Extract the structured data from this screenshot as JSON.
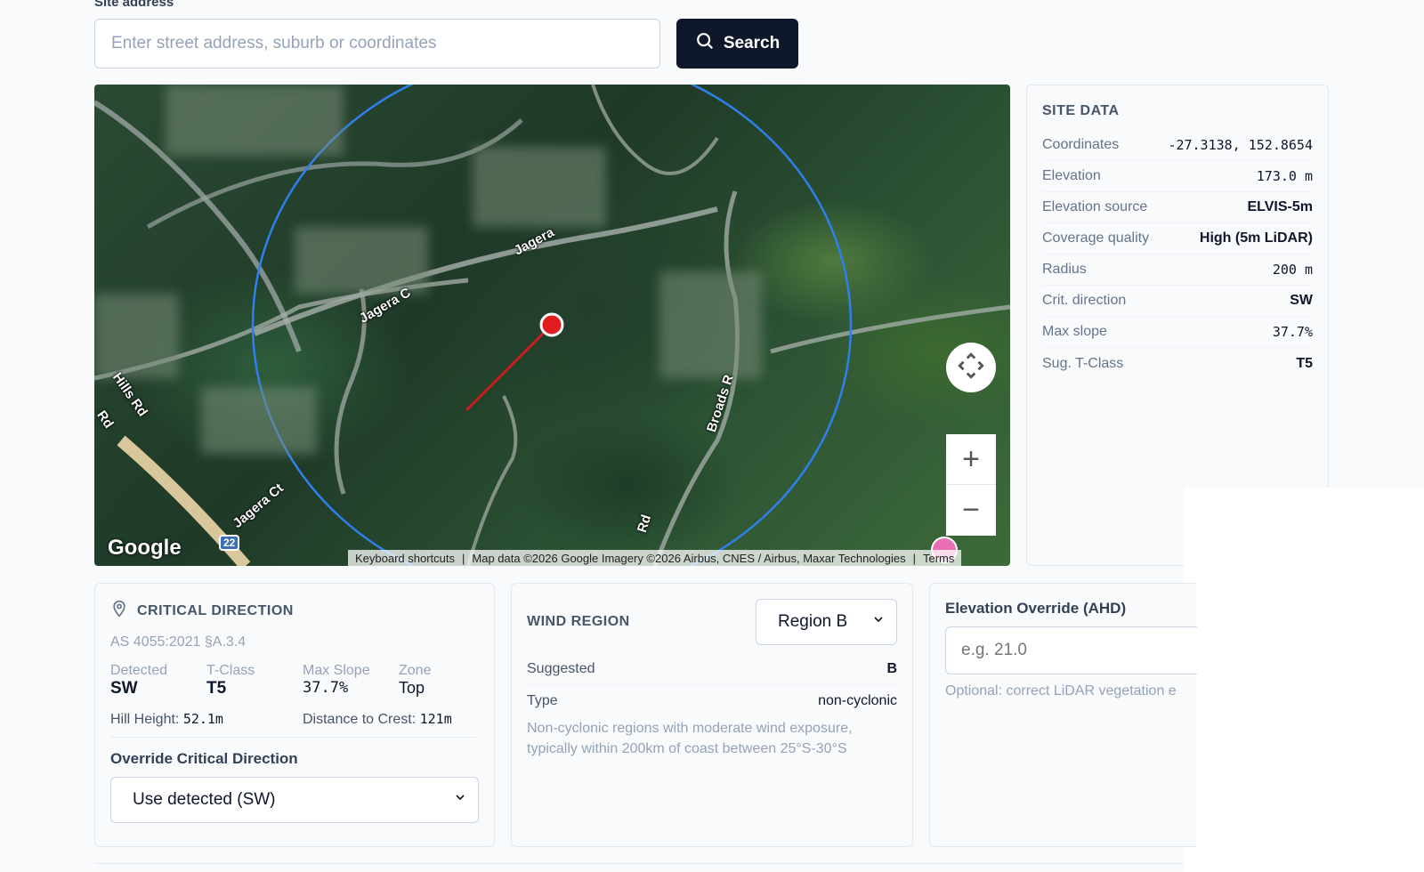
{
  "search": {
    "label": "Site address",
    "placeholder": "Enter street address, suburb or coordinates",
    "button_label": "Search"
  },
  "map": {
    "labels": [
      "Jagera",
      "Jagera C",
      "Hills Rd",
      "Rd",
      "Jagera Ct",
      "Broads R",
      "Rd",
      "22"
    ],
    "attribution": {
      "shortcuts": "Keyboard shortcuts",
      "data": "Map data ©2026 Google Imagery ©2026 Airbus, CNES / Airbus, Maxar Technologies",
      "terms": "Terms"
    },
    "logo": "Google",
    "zoom_in": "+",
    "zoom_out": "−"
  },
  "site_data": {
    "title": "SITE DATA",
    "rows": [
      {
        "k": "Coordinates",
        "v": "-27.3138, 152.8654"
      },
      {
        "k": "Elevation",
        "v": "173.0 m"
      },
      {
        "k": "Elevation source",
        "v": "ELVIS-5m"
      },
      {
        "k": "Coverage quality",
        "v": "High (5m LiDAR)"
      },
      {
        "k": "Radius",
        "v": "200 m"
      },
      {
        "k": "Crit. direction",
        "v": "SW"
      },
      {
        "k": "Max slope",
        "v": "37.7%"
      },
      {
        "k": "Sug. T-Class",
        "v": "T5"
      }
    ]
  },
  "critical_direction": {
    "title": "CRITICAL DIRECTION",
    "standard": "AS 4055:2021 §A.3.4",
    "detected_label": "Detected",
    "detected": "SW",
    "tclass_label": "T-Class",
    "tclass": "T5",
    "maxslope_label": "Max Slope",
    "maxslope": "37.7%",
    "zone_label": "Zone",
    "zone": "Top",
    "hill_label": "Hill Height:",
    "hill": "52.1m",
    "crest_label": "Distance to Crest:",
    "crest": "121m",
    "override_label": "Override Critical Direction",
    "override_value": "Use detected (SW)"
  },
  "wind_region": {
    "title": "WIND REGION",
    "selected": "Region B",
    "suggested_label": "Suggested",
    "suggested": "B",
    "type_label": "Type",
    "type": "non-cyclonic",
    "description": "Non-cyclonic regions with moderate wind exposure, typically within 200km of coast between 25°S-30°S"
  },
  "elevation_override": {
    "title": "Elevation Override (AHD)",
    "placeholder": "e.g. 21.0",
    "hint": "Optional: correct LiDAR vegetation e"
  },
  "colors": {
    "primary": "#0f172a",
    "radius_circle": "#2f80ed",
    "marker": "#e11d1d",
    "direction_line": "#c81e1e"
  }
}
